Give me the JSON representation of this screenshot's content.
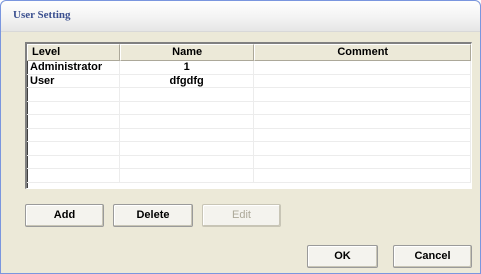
{
  "window": {
    "title": "User Setting"
  },
  "table": {
    "columns": [
      "Level",
      "Name",
      "Comment"
    ],
    "rows": [
      [
        "Administrator",
        "1",
        ""
      ],
      [
        "User",
        "dfgdfg",
        ""
      ],
      [
        "",
        "",
        ""
      ],
      [
        "",
        "",
        ""
      ],
      [
        "",
        "",
        ""
      ],
      [
        "",
        "",
        ""
      ],
      [
        "",
        "",
        ""
      ],
      [
        "",
        "",
        ""
      ],
      [
        "",
        "",
        ""
      ]
    ]
  },
  "buttons": {
    "add": "Add",
    "delete": "Delete",
    "edit": "Edit",
    "ok": "OK",
    "cancel": "Cancel"
  }
}
